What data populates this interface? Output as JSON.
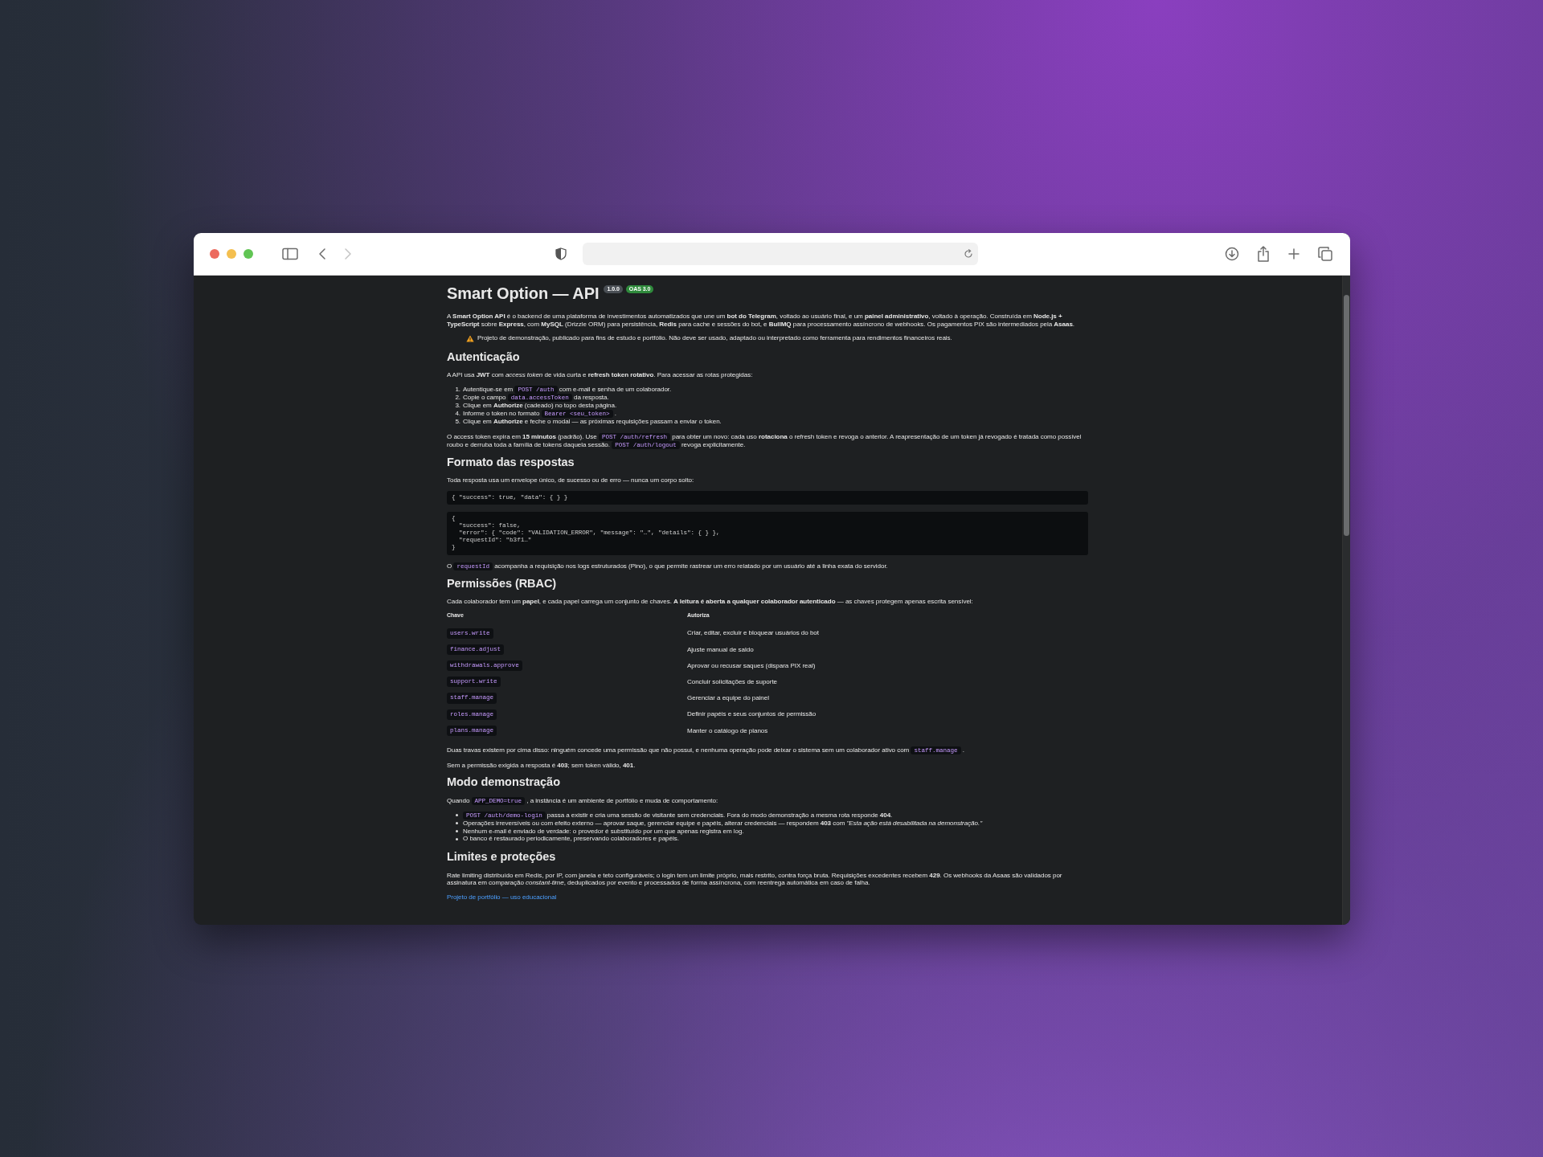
{
  "browser": {
    "traffic_lights": [
      {
        "color": "#ec6a5e"
      },
      {
        "color": "#f4bf4f"
      },
      {
        "color": "#61c554"
      }
    ],
    "nav": [
      {
        "kind": "back",
        "disabled": false
      },
      {
        "kind": "forward",
        "disabled": true
      }
    ]
  },
  "page": {
    "title": "Smart Option — API",
    "badges": [
      {
        "text": "1.0.0",
        "color": "#4a4f55"
      },
      {
        "text": "OAS 3.0",
        "color": "#2f8a3c"
      }
    ],
    "blocks": [
      {
        "kind": "paragraph",
        "parts": [
          {
            "kind": "text",
            "text": "A **Smart Option API** é o backend de uma plataforma de investimentos automatizados que une um **bot do Telegram**, voltado ao usuário final, e um **painel administrativo**, voltado à operação. Construída em **Node.js + TypeScript** sobre **Express**, com **MySQL** (Drizzle ORM) para persistência, **Redis** para cache e sessões do bot, e **BullMQ** para processamento assíncrono de webhooks. Os pagamentos PIX são intermediados pela **Asaas**."
          }
        ]
      },
      {
        "kind": "note",
        "text": "Projeto de demonstração, publicado para fins de estudo e portfólio. Não deve ser usado, adaptado ou interpretado como ferramenta para rendimentos financeiros reais."
      },
      {
        "kind": "heading",
        "text": "Autenticação"
      },
      {
        "kind": "paragraph",
        "parts": [
          {
            "kind": "text",
            "text": "A API usa **JWT** com *access token* de vida curta e **refresh token rotativo**. Para acessar as rotas protegidas:"
          }
        ]
      },
      {
        "kind": "ordered_list",
        "items": [
          {
            "number": "1.",
            "parts": [
              {
                "kind": "text",
                "text": "Autentique-se em "
              },
              {
                "kind": "code",
                "text": "POST /auth"
              },
              {
                "kind": "text",
                "text": " com e-mail e senha de um colaborador."
              }
            ]
          },
          {
            "number": "2.",
            "parts": [
              {
                "kind": "text",
                "text": "Copie o campo "
              },
              {
                "kind": "code",
                "text": "data.accessToken"
              },
              {
                "kind": "text",
                "text": " da resposta."
              }
            ]
          },
          {
            "number": "3.",
            "parts": [
              {
                "kind": "text",
                "text": "Clique em **Authorize** (cadeado) no topo desta página."
              }
            ]
          },
          {
            "number": "4.",
            "parts": [
              {
                "kind": "text",
                "text": "Informe o token no formato "
              },
              {
                "kind": "code",
                "text": "Bearer <seu_token>"
              },
              {
                "kind": "text",
                "text": " ."
              }
            ]
          },
          {
            "number": "5.",
            "parts": [
              {
                "kind": "text",
                "text": "Clique em **Authorize** e feche o modal — as próximas requisições passam a enviar o token."
              }
            ]
          }
        ]
      },
      {
        "kind": "paragraph",
        "parts": [
          {
            "kind": "text",
            "text": "O access token expira em **15 minutos** (padrão). Use "
          },
          {
            "kind": "code",
            "text": "POST /auth/refresh"
          },
          {
            "kind": "text",
            "text": " para obter um novo: cada uso **rotaciona** o refresh token e revoga o anterior. A reapresentação de um token já revogado é tratada como possível roubo e derruba toda a família de tokens daquela sessão. "
          },
          {
            "kind": "code",
            "text": "POST /auth/logout"
          },
          {
            "kind": "text",
            "text": " revoga explicitamente."
          }
        ]
      },
      {
        "kind": "heading",
        "text": "Formato das respostas"
      },
      {
        "kind": "paragraph",
        "parts": [
          {
            "kind": "text",
            "text": "Toda resposta usa um envelope único, de sucesso ou de erro — nunca um corpo solto:"
          }
        ]
      },
      {
        "kind": "code_block",
        "lines": [
          "{ \"success\": true, \"data\": { } }"
        ]
      },
      {
        "kind": "code_block",
        "lines": [
          "{",
          "  \"success\": false,",
          "  \"error\": { \"code\": \"VALIDATION_ERROR\", \"message\": \"…\", \"details\": { } },",
          "  \"requestId\": \"b3f1…\"",
          "}"
        ]
      },
      {
        "kind": "paragraph",
        "parts": [
          {
            "kind": "text",
            "text": "O "
          },
          {
            "kind": "code",
            "text": "requestId"
          },
          {
            "kind": "text",
            "text": " acompanha a requisição nos logs estruturados (Pino), o que permite rastrear um erro relatado por um usuário até a linha exata do servidor."
          }
        ]
      },
      {
        "kind": "heading",
        "text": "Permissões (RBAC)"
      },
      {
        "kind": "paragraph",
        "parts": [
          {
            "kind": "text",
            "text": "Cada colaborador tem um **papel**, e cada papel carrega um conjunto de chaves. **A leitura é aberta a qualquer colaborador autenticado** — as chaves protegem apenas escrita sensível:"
          }
        ]
      },
      {
        "kind": "table",
        "columns": [
          "Chave",
          "Autoriza"
        ],
        "rows": [
          {
            "key": "users.write",
            "description": "Criar, editar, excluir e bloquear usuários do bot"
          },
          {
            "key": "finance.adjust",
            "description": "Ajuste manual de saldo"
          },
          {
            "key": "withdrawals.approve",
            "description": "Aprovar ou recusar saques (dispara PIX real)"
          },
          {
            "key": "support.write",
            "description": "Concluir solicitações de suporte"
          },
          {
            "key": "staff.manage",
            "description": "Gerenciar a equipe do painel"
          },
          {
            "key": "roles.manage",
            "description": "Definir papéis e seus conjuntos de permissão"
          },
          {
            "key": "plans.manage",
            "description": "Manter o catálogo de planos"
          }
        ]
      },
      {
        "kind": "paragraph",
        "parts": [
          {
            "kind": "text",
            "text": "Duas travas existem por cima disso: ninguém concede uma permissão que não possui, e nenhuma operação pode deixar o sistema sem um colaborador ativo com "
          },
          {
            "kind": "code",
            "text": "staff.manage"
          },
          {
            "kind": "text",
            "text": " ."
          }
        ]
      },
      {
        "kind": "paragraph",
        "parts": [
          {
            "kind": "text",
            "text": "Sem a permissão exigida a resposta é **403**; sem token válido, **401**."
          }
        ]
      },
      {
        "kind": "heading",
        "text": "Modo demonstração"
      },
      {
        "kind": "paragraph",
        "parts": [
          {
            "kind": "text",
            "text": "Quando "
          },
          {
            "kind": "code",
            "text": "APP_DEMO=true"
          },
          {
            "kind": "text",
            "text": " , a instância é um ambiente de portfólio e muda de comportamento:"
          }
        ]
      },
      {
        "kind": "bullet_list",
        "items": [
          {
            "parts": [
              {
                "kind": "code",
                "text": "POST /auth/demo-login"
              },
              {
                "kind": "text",
                "text": " passa a existir e cria uma sessão de visitante sem credenciais. Fora do modo demonstração a mesma rota responde **404**."
              }
            ]
          },
          {
            "parts": [
              {
                "kind": "text",
                "text": "Operações irreversíveis ou com efeito externo — aprovar saque, gerenciar equipe e papéis, alterar credenciais — respondem **403** com *\"Esta ação está desabilitada na demonstração.\"*"
              }
            ]
          },
          {
            "parts": [
              {
                "kind": "text",
                "text": "Nenhum e-mail é enviado de verdade: o provedor é substituído por um que apenas registra em log."
              }
            ]
          },
          {
            "parts": [
              {
                "kind": "text",
                "text": "O banco é restaurado periodicamente, preservando colaboradores e papéis."
              }
            ]
          }
        ]
      },
      {
        "kind": "heading",
        "text": "Limites e proteções"
      },
      {
        "kind": "paragraph",
        "parts": [
          {
            "kind": "text",
            "text": "Rate limiting distribuído em Redis, por IP, com janela e teto configuráveis; o login tem um limite próprio, mais restrito, contra força bruta. Requisições excedentes recebem **429**. Os webhooks da Asaas são validados por assinatura em comparação *constant-time*, deduplicados por evento e processados de forma assíncrona, com reentrega automática em caso de falha."
          }
        ]
      },
      {
        "kind": "link",
        "text": "Projeto de portfólio — uso educacional"
      }
    ]
  }
}
